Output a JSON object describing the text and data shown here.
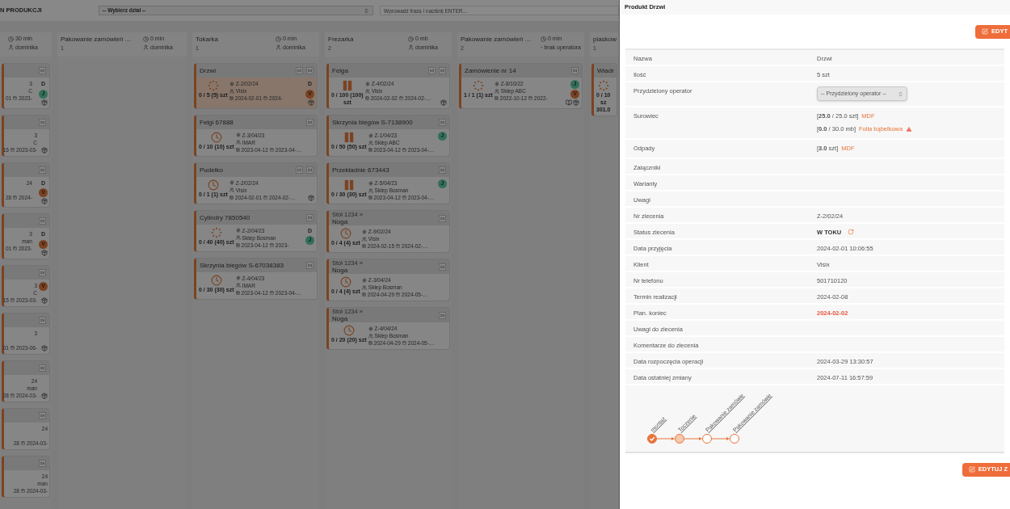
{
  "board": {
    "title": "N PRODUKCJI",
    "department_select": {
      "placeholder": "-- Wybierz dział --"
    },
    "search": {
      "placeholder": "Wprowadź frazę i naciśnij ENTER..."
    },
    "columns": [
      {
        "clipped_left": true,
        "time": "30 min",
        "operator": "dominika",
        "cards": [
          {
            "next_button": true,
            "order": "3",
            "client": "C",
            "date_start": "01",
            "date_end": "2023-",
            "badges": [
              {
                "text": "D"
              },
              {
                "text": "J",
                "color": "#336f58"
              }
            ],
            "package_icon": true,
            "selected": false
          },
          {
            "next_button": true,
            "order": "3",
            "client": "C",
            "date_start": "16",
            "date_end": "2023-03-",
            "package_icon": true,
            "selected": false
          },
          {
            "next_button": true,
            "order": "24",
            "date_start": "28",
            "date_end": "2024-",
            "badges": [
              {
                "text": "D"
              },
              {
                "text": "V",
                "color": "#7b4220"
              }
            ],
            "package_icon": true,
            "selected": false
          },
          {
            "next_button": true,
            "order": "3",
            "client": "man",
            "date_start": "01",
            "date_end": "2023-",
            "badges": [
              {
                "text": "D"
              },
              {
                "text": "V",
                "color": "#7b4220"
              }
            ],
            "package_icon": true,
            "selected": false
          },
          {
            "next_button": true,
            "order": "3",
            "client": "C",
            "date_start": "15",
            "date_end": "2023-03-",
            "badges": [
              {
                "text": "V",
                "color": "#7b4220"
              }
            ],
            "package_icon": true,
            "selected": false
          },
          {
            "next_button": true,
            "order": "3",
            "date_start": "01",
            "date_end": "2023-06-",
            "package_icon": true,
            "selected": false
          },
          {
            "next_button": true,
            "order": "24",
            "client": "man",
            "date_start": "28",
            "date_end": "2024-03-",
            "package_icon": true,
            "selected": false
          },
          {
            "next_button": true,
            "order": "24",
            "date_start": "28",
            "date_end": "2024-03-",
            "selected": false
          },
          {
            "next_button": true,
            "order": "24",
            "client": "man",
            "date_start": "28",
            "date_end": "2024-03-",
            "selected": false
          }
        ]
      },
      {
        "name": "Pakowanie zamówień …",
        "count": "1",
        "time": "0 min",
        "operator": "dominika"
      },
      {
        "name": "Tokarka",
        "count": "1",
        "time": "0 min",
        "operator": "dominika",
        "cards": [
          {
            "title": "Drzwi",
            "prev_button": true,
            "next_button": true,
            "status": {
              "kind": "in_progress"
            },
            "qty": [
              "0 / 5 (5) szt"
            ],
            "order": "Z-2/02/24",
            "client": "Visix",
            "date_start": "2024-02-01",
            "date_end": "2024-",
            "badges": [
              {
                "text": "D"
              },
              {
                "text": "V",
                "color": "#7b4220"
              }
            ],
            "package_icon": true,
            "selected": true
          },
          {
            "title": "Felgi 67888",
            "next_button": true,
            "status": {
              "kind": "waiting"
            },
            "qty": [
              "0 / 10 (10) szt"
            ],
            "order": "Z-3/04/23",
            "client": "IMAR",
            "date_start": "2023-04-12",
            "date_end": "2023-04-…",
            "selected": false
          },
          {
            "title": "Pudełko",
            "prev_button": true,
            "next_button": true,
            "status": {
              "kind": "waiting"
            },
            "qty": [
              "0 / 1 (1) szt"
            ],
            "order": "Z-2/02/24",
            "client": "Visix",
            "date_start": "2024-02-01",
            "date_end": "2024-02-…",
            "package_icon": true,
            "selected": false
          },
          {
            "title": "Cylindry 7850540",
            "next_button": true,
            "status": {
              "kind": "in_progress"
            },
            "qty": [
              "0 / 40 (40) szt"
            ],
            "order": "Z-2/04/23",
            "client": "Sklep Bosman",
            "date_start": "2023-04-12",
            "date_end": "2023-",
            "badges": [
              {
                "text": "D"
              },
              {
                "text": "J",
                "color": "#336f58"
              }
            ],
            "selected": false
          },
          {
            "title": "Skrzynia biegów S-67038383",
            "next_button": true,
            "status": {
              "kind": "waiting"
            },
            "qty": [
              "0 / 30 (30) szt"
            ],
            "order": "Z-4/04/23",
            "client": "IMAR",
            "date_start": "2023-04-12",
            "date_end": "2023-04-…",
            "selected": false
          }
        ]
      },
      {
        "name": "Frezarka",
        "count": "2",
        "time": "0 mb",
        "operator": "dominika",
        "cards": [
          {
            "title": "Felga",
            "prev_button": true,
            "next_button": true,
            "status": {
              "kind": "paused"
            },
            "qty": [
              "0 / 100 (100)",
              "szt"
            ],
            "order": "Z-4/02/24",
            "client": "Visix",
            "date_start": "2024-02-02",
            "date_end": "2024-02-…",
            "package_icon": true,
            "selected": false
          },
          {
            "title": "Skrzynia biegów S-7138900",
            "next_button": true,
            "status": {
              "kind": "paused"
            },
            "qty": [
              "0 / 50 (50) szt"
            ],
            "order": "Z-1/04/23",
            "client": "Sklep ABC",
            "date_start": "2023-04-12",
            "date_end": "2023-04-…",
            "badges": [
              {
                "text": "J",
                "color": "#336f58"
              }
            ],
            "selected": false
          },
          {
            "title": "Przekładnie 673443",
            "next_button": true,
            "status": {
              "kind": "paused"
            },
            "qty": [
              "0 / 30 (30) szt"
            ],
            "order": "Z-5/04/23",
            "client": "Sklep Bosman",
            "date_start": "2023-04-12",
            "date_end": "2023-04-…",
            "badges": [
              {
                "text": "J",
                "color": "#336f58"
              }
            ],
            "selected": false
          },
          {
            "parent": "Stół 1234 »",
            "title": "Noga",
            "next_button": true,
            "status": {
              "kind": "waiting"
            },
            "qty": [
              "0 / 4 (4) szt"
            ],
            "order": "Z-9/02/24",
            "client": "Visix",
            "date_start": "2024-02-15",
            "date_end": "2024-02-…",
            "selected": false
          },
          {
            "parent": "Stół 1234 »",
            "title": "Noga",
            "next_button": true,
            "status": {
              "kind": "waiting"
            },
            "qty": [
              "0 / 4 (4) szt"
            ],
            "order": "Z-3/04/24",
            "client": "Sklep Bosman",
            "date_start": "2024-04-29",
            "date_end": "2024-05-…",
            "selected": false
          },
          {
            "parent": "Stół 1234 »",
            "title": "Noga",
            "next_button": true,
            "status": {
              "kind": "waiting"
            },
            "qty": [
              "0 / 20 (20) szt"
            ],
            "order": "Z-4/04/24",
            "client": "Sklep Bosman",
            "date_start": "2024-04-29",
            "date_end": "2024-05-…",
            "selected": false
          }
        ]
      },
      {
        "name": "Pakowanie zamówień …",
        "count": "2",
        "time": "0 min",
        "operator": "brak operatora",
        "cards": [
          {
            "title": "Zamówienie nr 14",
            "next_button": true,
            "status": {
              "kind": "in_progress"
            },
            "qty": [
              "1 / 1 (1) szt"
            ],
            "order": "Z-8/10/22",
            "client": "Sklep ABC",
            "date_start": "2022-10-12",
            "date_end": "2022-",
            "badges": [
              {
                "text": "J",
                "color": "#336f58"
              },
              {
                "text": "V",
                "color": "#7b4220"
              }
            ],
            "book_icon": true,
            "package_icon": true,
            "selected": false
          }
        ]
      },
      {
        "clipped_right": true,
        "name": "piaskow",
        "count": "1",
        "cards": [
          {
            "title": "Wiadr",
            "status": {
              "kind": "in_progress"
            },
            "qty": [
              "0 / 10",
              "sz",
              "301.0"
            ],
            "selected": false
          }
        ]
      }
    ]
  },
  "panel": {
    "title": "Produkt Drzwi",
    "edit_button": "EDYT",
    "rows": [
      {
        "kind": "text",
        "label": "Nazwa",
        "value": "Drzwi"
      },
      {
        "kind": "text",
        "label": "Ilość",
        "value": "5 szt"
      },
      {
        "kind": "select",
        "label": "Przydzielony operator",
        "placeholder": "-- Przydzielony operator --"
      },
      {
        "kind": "materials",
        "label": "Surowiec",
        "items": [
          {
            "amount": "[**25.0** / 25.0 szt]",
            "name": "MDF",
            "warning": false
          },
          {
            "amount": "[**0.0** / 30.0 mb]",
            "name": "Folia bąbelkowa",
            "warning": true
          }
        ]
      },
      {
        "kind": "materials",
        "label": "Odpady",
        "items": [
          {
            "amount": "[**3.0** szt]",
            "name": "MDF",
            "warning": false
          }
        ]
      },
      {
        "kind": "text",
        "label": "Załączniki"
      },
      {
        "kind": "text",
        "label": "Warianty"
      },
      {
        "kind": "text",
        "label": "Uwagi"
      },
      {
        "kind": "text",
        "label": "Nr zlecenia",
        "value": "Z-2/02/24"
      },
      {
        "kind": "status",
        "label": "Status zlecenia",
        "value": "W TOKU"
      },
      {
        "kind": "text",
        "label": "Data przyjęcia",
        "value": "2024-02-01 10:06:55"
      },
      {
        "kind": "text",
        "label": "Klient",
        "value": "Visix"
      },
      {
        "kind": "text",
        "label": "Nr telefonu",
        "value": "501710120"
      },
      {
        "kind": "text",
        "label": "Termin realizacji",
        "value": "2024-02-08"
      },
      {
        "kind": "alert",
        "label": "Plan. koniec",
        "value": "2024-02-02"
      },
      {
        "kind": "text",
        "label": "Uwagi do zlecenia"
      },
      {
        "kind": "text",
        "label": "Komentarze do zlecenia"
      },
      {
        "kind": "text",
        "label": "Data rozpoczęcia operacji",
        "value": "2024-03-29 13:30:57"
      },
      {
        "kind": "text",
        "label": "Data ostatniej zmiany",
        "value": "2024-07-11 16:57:59"
      }
    ],
    "workflow": [
      {
        "label": "montaż",
        "kind": "done"
      },
      {
        "label": "Toczenie",
        "kind": "in_progress"
      },
      {
        "label": "Pakowanie zamówie",
        "kind": "todo"
      },
      {
        "label": "Pakowanie zamówie",
        "kind": "todo"
      }
    ],
    "bottom_button": "EDYTUJ Z"
  }
}
